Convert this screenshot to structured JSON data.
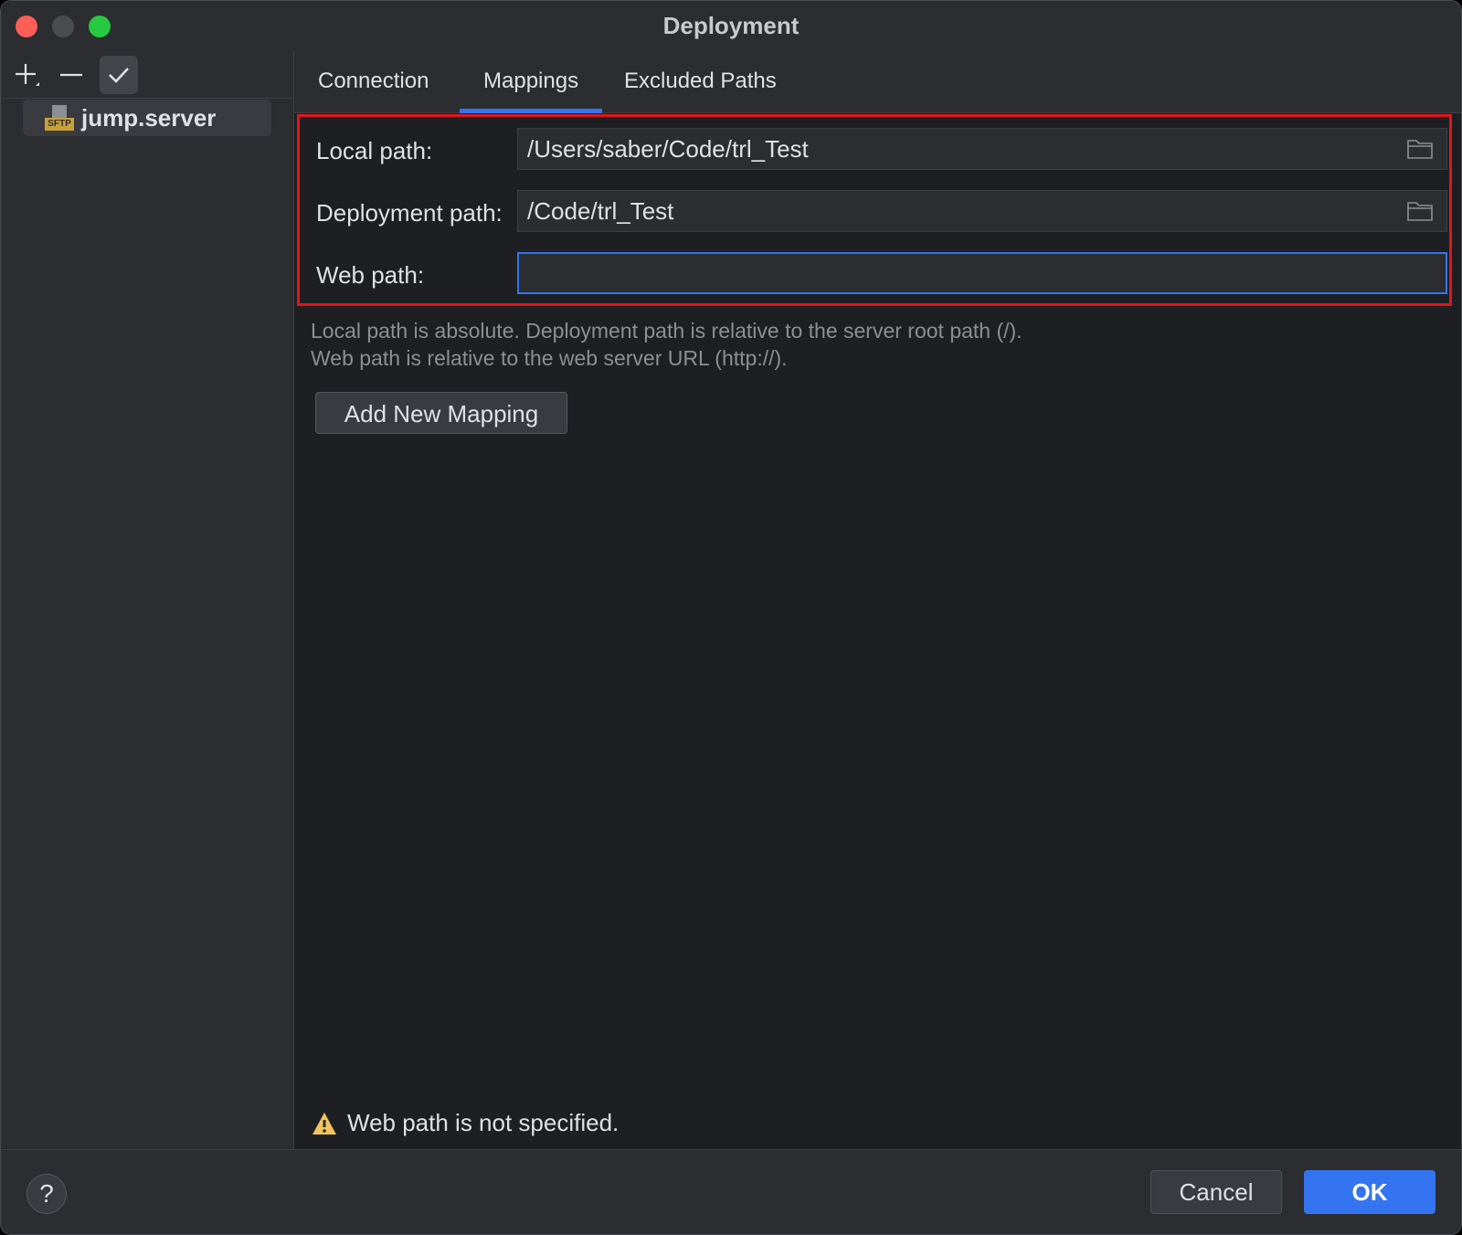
{
  "window": {
    "title": "Deployment"
  },
  "sidebar": {
    "tools": {
      "add_icon": "plus-icon",
      "remove_icon": "minus-icon",
      "default_icon": "check-icon"
    },
    "servers": [
      {
        "label": "jump.server",
        "icon": "sftp-icon",
        "icon_text": "SFTP"
      }
    ]
  },
  "tabs": [
    {
      "label": "Connection",
      "active": false
    },
    {
      "label": "Mappings",
      "active": true
    },
    {
      "label": "Excluded Paths",
      "active": false
    }
  ],
  "mappings": {
    "local_path": {
      "label": "Local path:",
      "value": "/Users/saber/Code/trl_Test"
    },
    "deployment_path": {
      "label": "Deployment path:",
      "value": "/Code/trl_Test"
    },
    "web_path": {
      "label": "Web path:",
      "value": ""
    },
    "hint_line1": "Local path is absolute. Deployment path is relative to the server root path (/).",
    "hint_line2": "Web path is relative to the web server URL (http://).",
    "add_button": "Add New Mapping"
  },
  "warning": {
    "icon": "warning-icon",
    "text": "Web path is not specified."
  },
  "footer": {
    "help": "?",
    "cancel": "Cancel",
    "ok": "OK"
  },
  "colors": {
    "accent": "#3574f0",
    "highlight": "#e0161c",
    "warning": "#f2c55c"
  }
}
